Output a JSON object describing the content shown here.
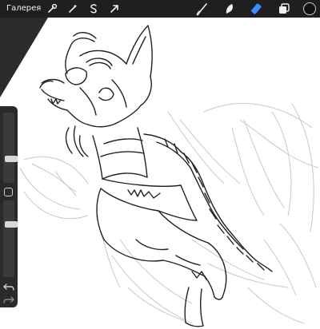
{
  "app": {
    "gallery_label": "Галерея"
  },
  "toolbar": {
    "left_tools": [
      {
        "name": "actions",
        "icon": "wrench-icon"
      },
      {
        "name": "adjustments",
        "icon": "magic-wand-icon"
      },
      {
        "name": "selection",
        "icon": "selection-s-icon"
      },
      {
        "name": "transform",
        "icon": "arrow-cursor-icon"
      }
    ],
    "right_tools": [
      {
        "name": "brush",
        "icon": "brush-icon"
      },
      {
        "name": "smudge",
        "icon": "smudge-icon"
      },
      {
        "name": "eraser",
        "icon": "eraser-icon",
        "active": true
      },
      {
        "name": "layers",
        "icon": "layers-icon"
      },
      {
        "name": "color",
        "icon": "color-swatch-icon"
      }
    ]
  },
  "colors": {
    "toolbar_bg": "#1f1f1f",
    "sidebar_bg": "#2a2a2a",
    "accent_active": "#3d8bff",
    "current_color": "#111111",
    "canvas_bg": "#ffffff"
  },
  "sidebar": {
    "brush_size_value": 0.45,
    "opacity_value": 0.3
  }
}
